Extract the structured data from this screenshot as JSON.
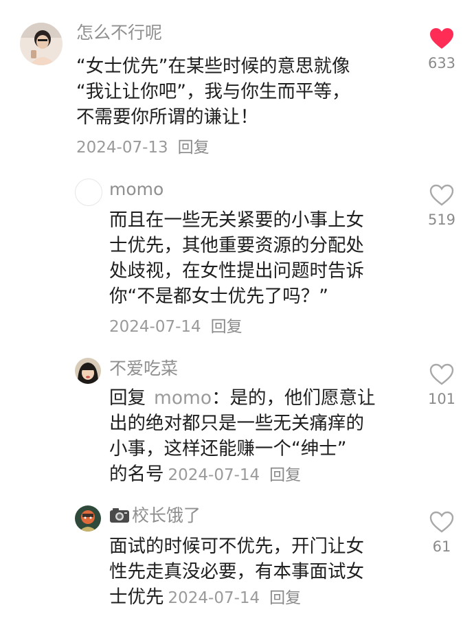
{
  "comments": [
    {
      "username": "怎么不行呢",
      "lines": [
        "“女士优先”在某些时候的意思就像",
        "“我让让你吧”，我与你生而平等，",
        "不需要你所谓的谦让！"
      ],
      "date": "2024-07-13",
      "reply_label": "回复",
      "likes": "633",
      "liked": true
    },
    {
      "username": "momo",
      "lines": [
        "而且在一些无关紧要的小事上女",
        "士优先，其他重要资源的分配处",
        "处歧视，在女性提出问题时告诉",
        "你“不是都女士优先了吗？”"
      ],
      "date": "2024-07-14",
      "reply_label": "回复",
      "likes": "519",
      "liked": false
    },
    {
      "username": "不爱吃菜",
      "reply_prefix": "回复",
      "reply_to": "momo",
      "lines": [
        "：是的，他们愿意让",
        "出的绝对都只是一些无关痛痒的",
        "小事，这样还能赚一个“绅士”",
        "的名号"
      ],
      "date": "2024-07-14",
      "reply_label": "回复",
      "likes": "101",
      "liked": false
    },
    {
      "username": "校长饿了",
      "name_icon": "camera-icon",
      "lines": [
        "面试的时候可不优先，开门让女",
        "性先走真没必要，有本事面试女",
        "士优先"
      ],
      "date": "2024-07-14",
      "reply_label": "回复",
      "likes": "61",
      "liked": false
    }
  ],
  "colors": {
    "like_active": "#ff2d55",
    "like_outline": "#a8a8a8",
    "meta": "#9a9a9a"
  }
}
